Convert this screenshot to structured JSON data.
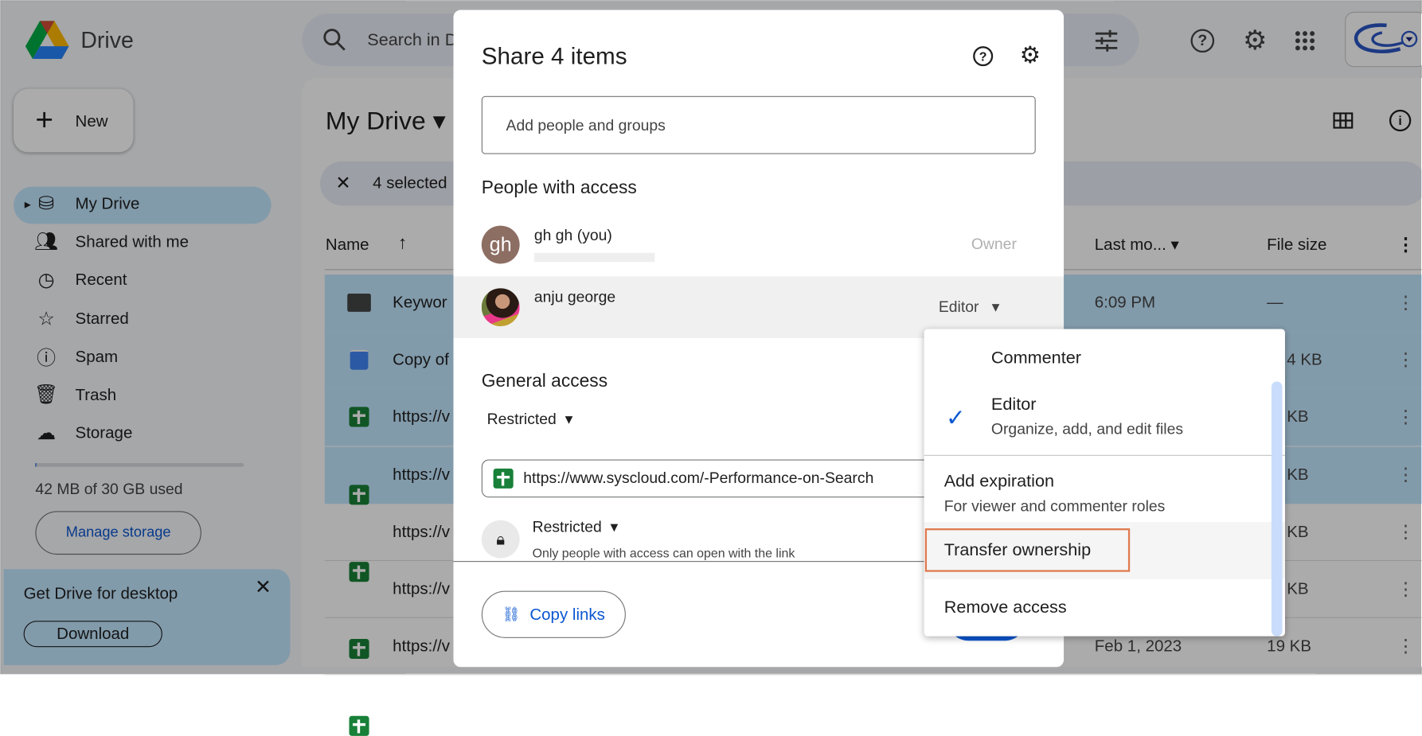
{
  "app": {
    "name": "Drive",
    "search_placeholder": "Search in Drive"
  },
  "sidebar": {
    "new_label": "New",
    "items": [
      {
        "label": "My Drive",
        "icon": "my-drive-icon",
        "selected": true
      },
      {
        "label": "Shared with me",
        "icon": "people-icon"
      },
      {
        "label": "Recent",
        "icon": "clock-icon"
      },
      {
        "label": "Starred",
        "icon": "star-icon"
      },
      {
        "label": "Spam",
        "icon": "spam-icon"
      },
      {
        "label": "Trash",
        "icon": "trash-icon"
      },
      {
        "label": "Storage",
        "icon": "cloud-icon"
      }
    ],
    "storage_text": "42 MB of 30 GB used",
    "storage_used_fraction": 0.0014,
    "manage_storage": "Manage storage",
    "promo": {
      "title": "Get Drive for desktop",
      "download": "Download"
    }
  },
  "main": {
    "title": "My Drive",
    "selected_count": "4 selected",
    "columns": {
      "name": "Name",
      "modified": "Last mo...",
      "size": "File size"
    },
    "rows": [
      {
        "name": "Keywor",
        "type": "shared-folder",
        "modified": "6:09 PM",
        "size": "—",
        "selected": true
      },
      {
        "name": "Copy of",
        "type": "doc",
        "modified": "",
        "size": "4 KB",
        "selected": true
      },
      {
        "name": "https://v",
        "type": "sheet",
        "modified": "",
        "size": "KB",
        "selected": true
      },
      {
        "name": "https://v",
        "type": "sheet",
        "modified": "",
        "size": "KB",
        "selected": true
      },
      {
        "name": "https://v",
        "type": "sheet",
        "modified": "",
        "size": "KB",
        "selected": false
      },
      {
        "name": "https://v",
        "type": "sheet",
        "modified": "",
        "size": "KB",
        "selected": false
      },
      {
        "name": "https://v",
        "type": "sheet",
        "modified": "Feb 1, 2023",
        "size": "19 KB",
        "selected": false
      }
    ]
  },
  "dialog": {
    "title": "Share 4 items",
    "add_placeholder": "Add people and groups",
    "people_heading": "People with access",
    "people": [
      {
        "initials": "gh",
        "name": "gh gh (you)",
        "role": "Owner"
      },
      {
        "name": "anju george",
        "role": "Editor"
      }
    ],
    "general_heading": "General access",
    "general_access": "Restricted",
    "link_text": "https://www.syscloud.com/-Performance-on-Search",
    "link_access": "Restricted",
    "link_access_desc": "Only people with access can open with the link",
    "copy_links": "Copy links"
  },
  "role_menu": {
    "items": [
      {
        "label": "Commenter"
      },
      {
        "label": "Editor",
        "desc": "Organize, add, and edit files",
        "checked": true
      },
      {
        "label": "Add expiration",
        "desc": "For viewer and commenter roles"
      },
      {
        "label": "Transfer ownership",
        "highlighted": true
      },
      {
        "label": "Remove access"
      }
    ]
  },
  "colors": {
    "accent": "#0b57d0",
    "highlight_border": "#e07a4f",
    "selected": "#c2e7ff"
  }
}
